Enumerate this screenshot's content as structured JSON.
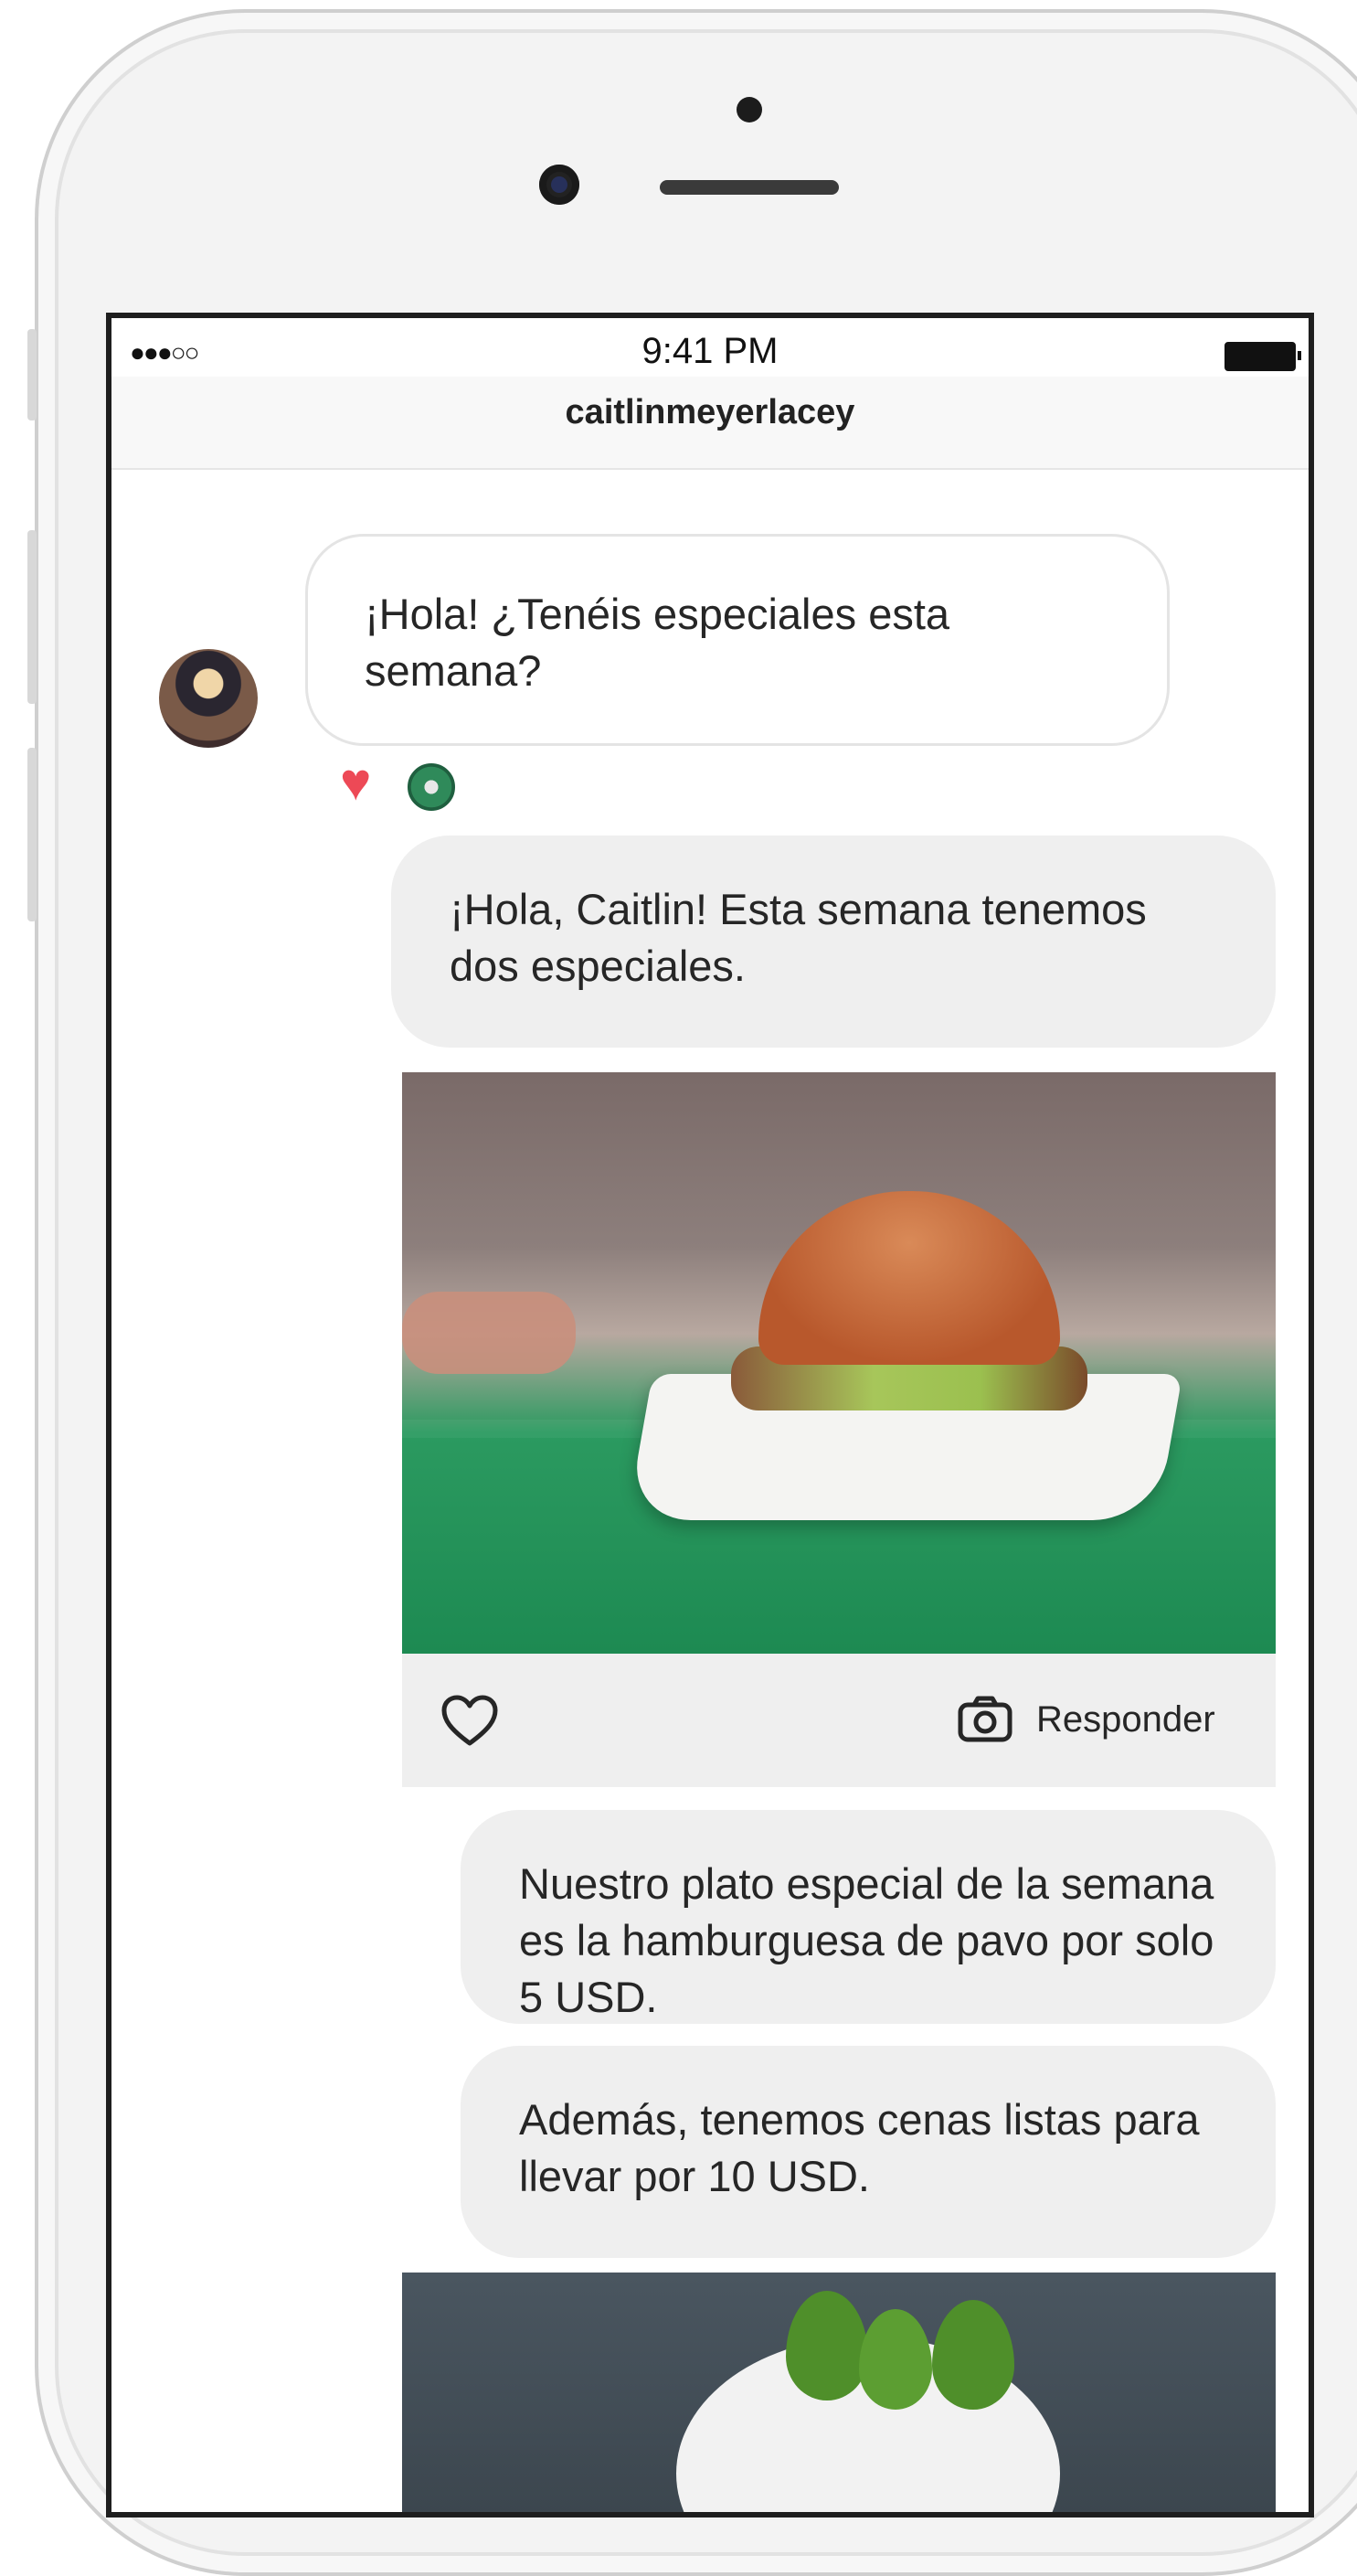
{
  "status_bar": {
    "signal": "●●●○○",
    "time": "9:41 PM"
  },
  "header": {
    "title": "caitlinmeyerlacey"
  },
  "messages": [
    {
      "direction": "incoming",
      "text": "¡Hola! ¿Tenéis especiales esta semana?"
    },
    {
      "direction": "outgoing",
      "text": "¡Hola, Caitlin! Esta semana tenemos dos especiales."
    },
    {
      "direction": "outgoing",
      "text": "Nuestro plato especial de la semana es la hamburguesa de pavo por solo 5 USD."
    },
    {
      "direction": "outgoing",
      "text": "Además, tenemos cenas listas para llevar por 10 USD."
    }
  ],
  "photo_message": {
    "reply_label": "Responder"
  },
  "icons": {
    "reaction": "heart-icon",
    "like": "heart-outline-icon",
    "reply": "camera-icon"
  },
  "colors": {
    "heart": "#ed4956",
    "bubble_out": "#efefef",
    "text": "#262626"
  }
}
